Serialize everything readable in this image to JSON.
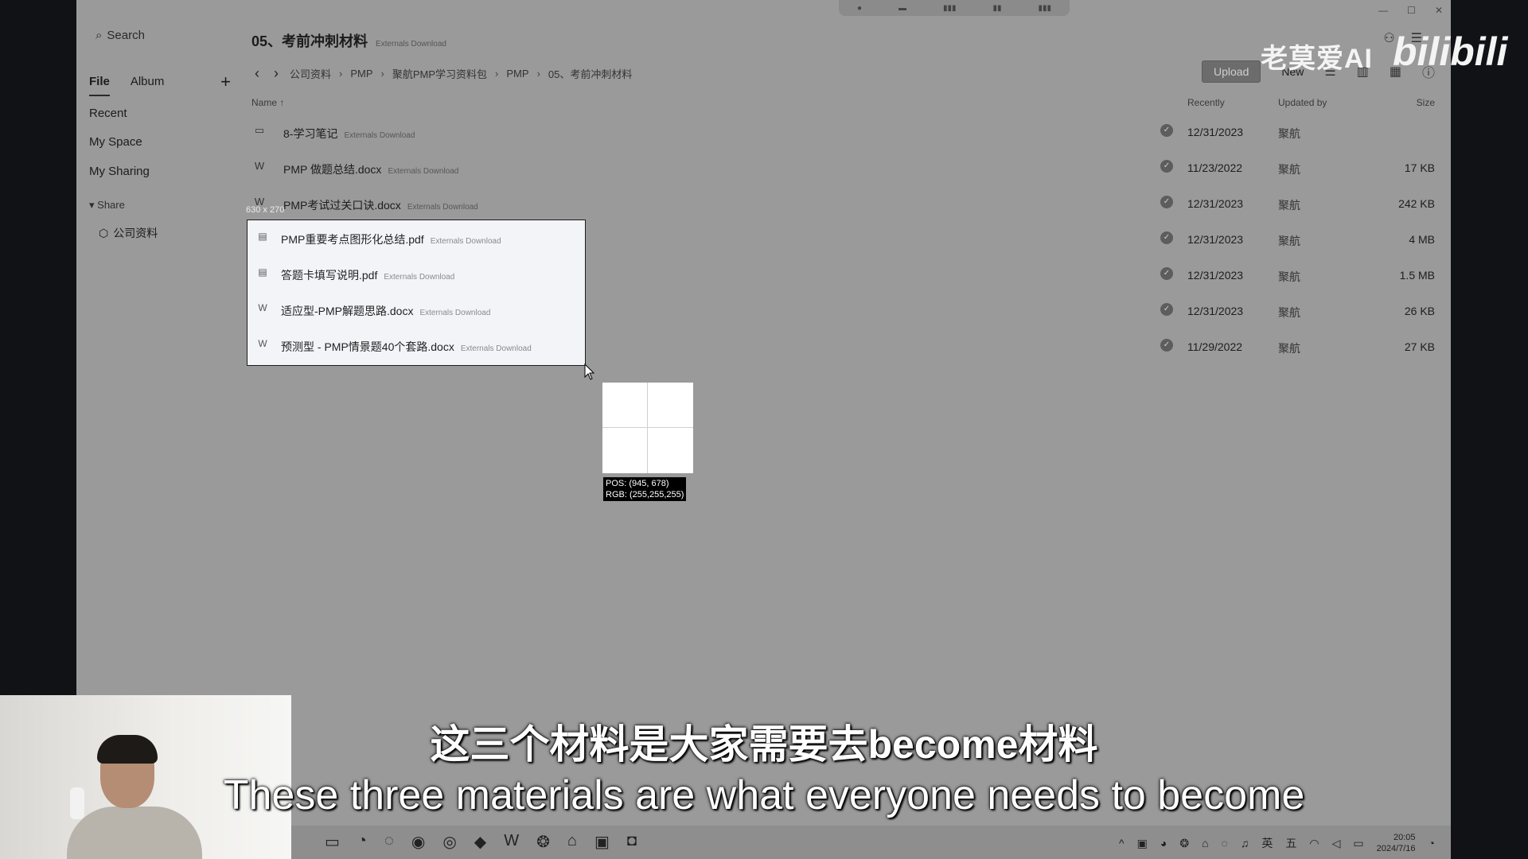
{
  "sidebar": {
    "search_label": "Search",
    "tabs": [
      {
        "label": "File",
        "active": true
      },
      {
        "label": "Album",
        "active": false
      }
    ],
    "add_label": "+",
    "nav": [
      {
        "label": "Recent"
      },
      {
        "label": "My Space"
      },
      {
        "label": "My Sharing"
      }
    ],
    "share_header": "Share",
    "share_items": [
      {
        "label": "公司资料"
      }
    ]
  },
  "header": {
    "title": "05、考前冲刺材料",
    "title_tag": "Externals Download",
    "breadcrumb": [
      "公司资料",
      "PMP",
      "聚航PMP学习资料包",
      "PMP",
      "05、考前冲刺材料"
    ],
    "upload_label": "Upload",
    "new_label": "New"
  },
  "columns": {
    "name": "Name ↑",
    "recent": "Recently",
    "updated_by": "Updated by",
    "size": "Size"
  },
  "files": [
    {
      "name": "8-学习笔记",
      "tag": "Externals Download",
      "date": "12/31/2023",
      "updater": "聚航",
      "size": "",
      "icon": "folder-icon"
    },
    {
      "name": "PMP 做题总结.docx",
      "tag": "Externals Download",
      "date": "11/23/2022",
      "updater": "聚航",
      "size": "17 KB",
      "icon": "word-icon"
    },
    {
      "name": "PMP考试过关口诀.docx",
      "tag": "Externals Download",
      "date": "12/31/2023",
      "updater": "聚航",
      "size": "242 KB",
      "icon": "word-icon"
    },
    {
      "name": "PMP重要考点图形化总结.pdf",
      "tag": "Externals Download",
      "date": "12/31/2023",
      "updater": "聚航",
      "size": "4 MB",
      "icon": "pdf-icon"
    },
    {
      "name": "答题卡填写说明.pdf",
      "tag": "Externals Download",
      "date": "12/31/2023",
      "updater": "聚航",
      "size": "1.5 MB",
      "icon": "pdf-icon"
    },
    {
      "name": "适应型-PMP解题思路.docx",
      "tag": "Externals Download",
      "date": "12/31/2023",
      "updater": "聚航",
      "size": "26 KB",
      "icon": "word-icon"
    },
    {
      "name": "预测型 - PMP情景题40个套路.docx",
      "tag": "Externals Download",
      "date": "11/29/2022",
      "updater": "聚航",
      "size": "27 KB",
      "icon": "word-icon"
    }
  ],
  "screenshot_tool": {
    "selection_size": "630 x 270",
    "pos": "POS: (945, 678)",
    "rgb": "RGB: (255,255,255)"
  },
  "watermark": {
    "text": "老莫爱AI",
    "brand": "bilibili"
  },
  "taskbar": {
    "time": "20:05",
    "date": "2024/7/16",
    "ime_1": "英",
    "ime_2": "五"
  },
  "subtitles": {
    "cn": "这三个材料是大家需要去become材料",
    "en": "These three materials are what everyone needs to become"
  },
  "colors": {
    "app_bg": "#9a9a9a",
    "selection_bg": "#f2f4f8"
  }
}
